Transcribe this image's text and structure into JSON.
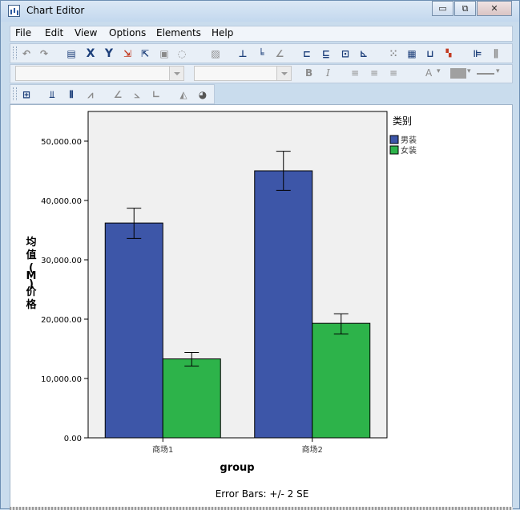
{
  "window": {
    "title": "Chart Editor",
    "minimize_glyph": "▭",
    "restore_glyph": "⧉",
    "close_glyph": "✕"
  },
  "menu": {
    "items": [
      "File",
      "Edit",
      "View",
      "Options",
      "Elements",
      "Help"
    ]
  },
  "toolbar_icons": {
    "row1": [
      "undo-icon",
      "redo-icon",
      "properties-icon",
      "x-axis-icon",
      "y-axis-icon",
      "rescale-icon",
      "transpose-icon",
      "rotate-icon",
      "lasso-icon",
      "zoom-icon",
      "bar-reference-icon",
      "reference-line-icon",
      "fit-line-icon",
      "annotation-icon",
      "textbox-icon",
      "footnote-icon",
      "title-icon",
      "grid-icon",
      "table-icon",
      "error-bar-icon",
      "data-label-icon",
      "legend-icon",
      "more-icon"
    ],
    "row2_format": [
      "bold-icon",
      "italic-icon",
      "align-left-icon",
      "align-center-icon",
      "align-right-icon",
      "text-color-icon",
      "fill-color-icon",
      "line-style-icon"
    ],
    "row3": [
      "select-icon",
      "bar-chart-icon",
      "clustered-bar-icon",
      "line-chart-icon",
      "scatter-icon",
      "fit-icon",
      "interpolate-icon",
      "area-icon",
      "pie-icon"
    ]
  },
  "format": {
    "bold_label": "B",
    "italic_label": "I",
    "text_color_label": "A"
  },
  "colors": {
    "series_male": "#3d56a8",
    "series_female": "#2db34a",
    "plot_background": "#f0f0f0"
  },
  "chart_data": {
    "type": "bar",
    "xlabel": "group",
    "ylabel": "均值(M)价格",
    "footnote": "Error Bars: +/- 2 SE",
    "legend_title": "类别",
    "legend_position": "top-right-outside",
    "categories": [
      "商场1",
      "商场2"
    ],
    "ylim": [
      0,
      55000
    ],
    "yticks": [
      0,
      10000,
      20000,
      30000,
      40000,
      50000
    ],
    "ytick_labels": [
      "0.00",
      "10,000.00",
      "20,000.00",
      "30,000.00",
      "40,000.00",
      "50,000.00"
    ],
    "grid": false,
    "series": [
      {
        "name": "男装",
        "values": [
          36200,
          45000
        ],
        "error_low": [
          33600,
          41700
        ],
        "error_high": [
          38700,
          48300
        ]
      },
      {
        "name": "女装",
        "values": [
          13300,
          19300
        ],
        "error_low": [
          12100,
          17500
        ],
        "error_high": [
          14400,
          20900
        ]
      }
    ]
  }
}
